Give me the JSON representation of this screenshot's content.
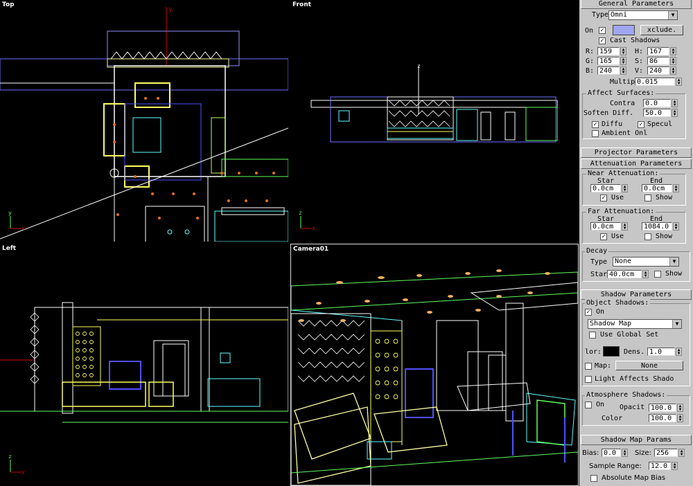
{
  "viewports": {
    "top": {
      "label": "Top"
    },
    "front": {
      "label": "Front"
    },
    "left": {
      "label": "Left"
    },
    "camera": {
      "label": "Camera01"
    }
  },
  "axes": {
    "x": "x",
    "y": "y",
    "z": "z"
  },
  "panel": {
    "general": {
      "title": "General Parameters",
      "type_label": "Type",
      "type_value": "Omni",
      "on_label": "On",
      "exclude_label": "xclude.",
      "cast_shadows_label": "Cast Shadows",
      "r_label": "R:",
      "r_value": "159",
      "g_label": "G:",
      "g_value": "165",
      "b_label": "B:",
      "b_value": "240",
      "h_label": "H:",
      "h_value": "167",
      "s_label": "S:",
      "s_value": "86",
      "v_label": "V:",
      "v_value": "240",
      "multiplier_label": "Multip",
      "multiplier_value": "0.015",
      "light_color": "#a0a5f0",
      "affect_title": "Affect Surfaces:",
      "contrast_label": "Contra",
      "contrast_value": "0.0",
      "soften_label": "Soften Diff.",
      "soften_value": "50.0",
      "diffuse_label": "Diffu",
      "specular_label": "Specul",
      "ambient_label": "Ambient Onl"
    },
    "projector": {
      "title": "Projector Parameters"
    },
    "attenuation": {
      "title": "Attenuation Parameters",
      "near_title": "Near Attenuation:",
      "near_start_label": "Star",
      "near_end_label": "End",
      "near_start_value": "0.0cm",
      "near_end_value": "0.0cm",
      "near_use_label": "Use",
      "near_show_label": "Show",
      "far_title": "Far Attenuation:",
      "far_start_label": "Star",
      "far_end_label": "End",
      "far_start_value": "0.0cm",
      "far_end_value": "1084.0",
      "far_use_label": "Use",
      "far_show_label": "Show"
    },
    "decay": {
      "title": "Decay",
      "type_label": "Type",
      "type_value": "None",
      "start_label": "Star",
      "start_value": "40.0cm",
      "show_label": "Show"
    },
    "shadow": {
      "title": "Shadow Parameters",
      "object_title": "Object Shadows:",
      "on_label": "On",
      "map_type": "Shadow Map",
      "use_global_label": "Use Global Set",
      "color_label": "lor:",
      "shadow_color": "#000000",
      "density_label": "Dens.",
      "density_value": "1.0",
      "map_label": "Map:",
      "map_value": "None",
      "light_affects_label": "Light Affects Shado",
      "atmos_title": "Atmosphere Shadows:",
      "atmos_on_label": "On",
      "opacity_label": "Opacit",
      "opacity_value": "100.0",
      "atmos_color_label": "Color",
      "atmos_color_value": "100.0"
    },
    "shadowmap": {
      "title": "Shadow Map Params",
      "bias_label": "Bias:",
      "bias_value": "0.0",
      "size_label": "Size:",
      "size_value": "256",
      "sample_label": "Sample Range:",
      "sample_value": "12.0",
      "absolute_label": "Absolute Map Bias"
    }
  }
}
